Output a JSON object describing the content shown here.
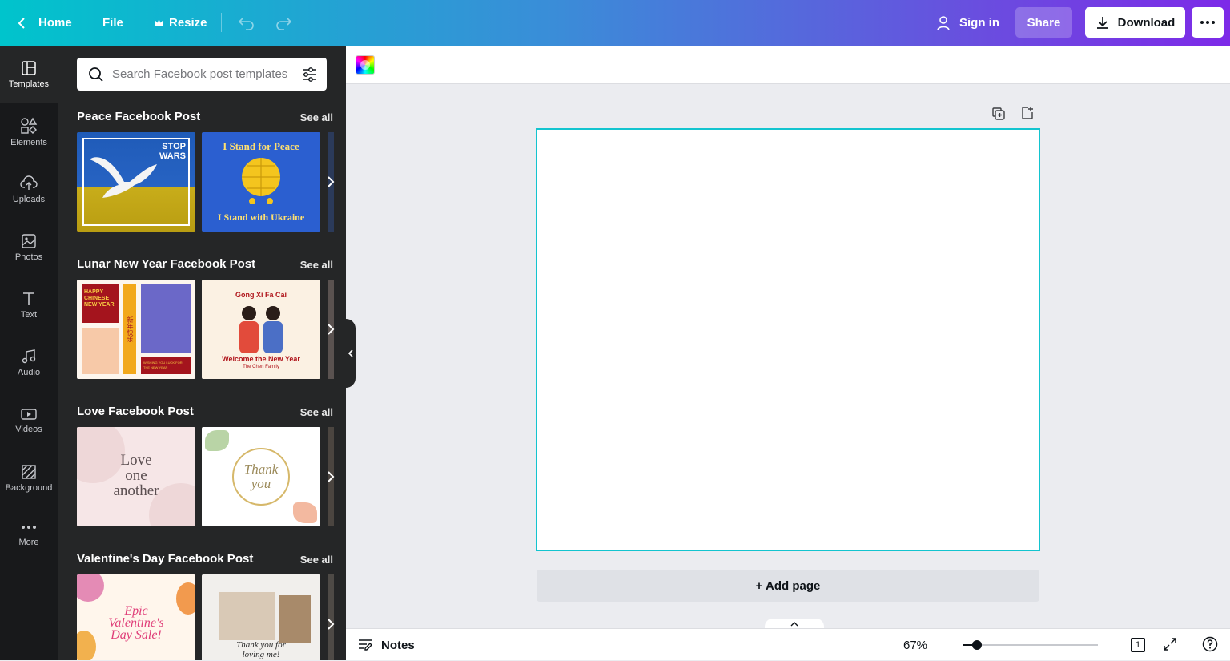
{
  "topbar": {
    "home_label": "Home",
    "file_label": "File",
    "resize_label": "Resize",
    "sign_in_label": "Sign in",
    "share_label": "Share",
    "download_label": "Download"
  },
  "rail": {
    "items": [
      {
        "label": "Templates",
        "icon": "templates-icon"
      },
      {
        "label": "Elements",
        "icon": "elements-icon"
      },
      {
        "label": "Uploads",
        "icon": "uploads-icon"
      },
      {
        "label": "Photos",
        "icon": "photos-icon"
      },
      {
        "label": "Text",
        "icon": "text-icon"
      },
      {
        "label": "Audio",
        "icon": "audio-icon"
      },
      {
        "label": "Videos",
        "icon": "videos-icon"
      },
      {
        "label": "Background",
        "icon": "background-icon"
      },
      {
        "label": "More",
        "icon": "more-icon"
      }
    ]
  },
  "panel": {
    "search_placeholder": "Search Facebook post templates",
    "see_all": "See all",
    "sections": [
      {
        "title": "Peace Facebook Post",
        "thumbs": [
          {
            "lines": [
              "STOP",
              "WARS"
            ]
          },
          {
            "lines": [
              "I Stand for Peace",
              "I Stand with Ukraine"
            ]
          }
        ]
      },
      {
        "title": "Lunar New Year Facebook Post",
        "thumbs": [
          {
            "lines": [
              "HAPPY",
              "CHINESE",
              "NEW YEAR",
              "新年快乐",
              "WISHING YOU LUCK FOR",
              "THE NEW YEAR"
            ]
          },
          {
            "lines": [
              "Gong Xi Fa Cai",
              "Welcome the New Year",
              "The Chen Family"
            ]
          }
        ]
      },
      {
        "title": "Love Facebook Post",
        "thumbs": [
          {
            "lines": [
              "Love",
              "one",
              "another"
            ]
          },
          {
            "lines": [
              "Thank",
              "you"
            ]
          }
        ]
      },
      {
        "title": "Valentine's Day Facebook Post",
        "thumbs": [
          {
            "lines": [
              "Epic",
              "Valentine's",
              "Day Sale!"
            ]
          },
          {
            "lines": [
              "Thank you for",
              "loving me!"
            ]
          }
        ]
      }
    ]
  },
  "canvas": {
    "add_page_label": "+ Add page"
  },
  "bottombar": {
    "notes_label": "Notes",
    "zoom_label": "67%",
    "zoom_fraction": 0.1,
    "page_count": "1"
  },
  "colors": {
    "gradient_start": "#00c4cc",
    "gradient_end": "#7d2ae8",
    "selection_border": "#13c4cf",
    "share_bg": "#8b5ff0"
  }
}
